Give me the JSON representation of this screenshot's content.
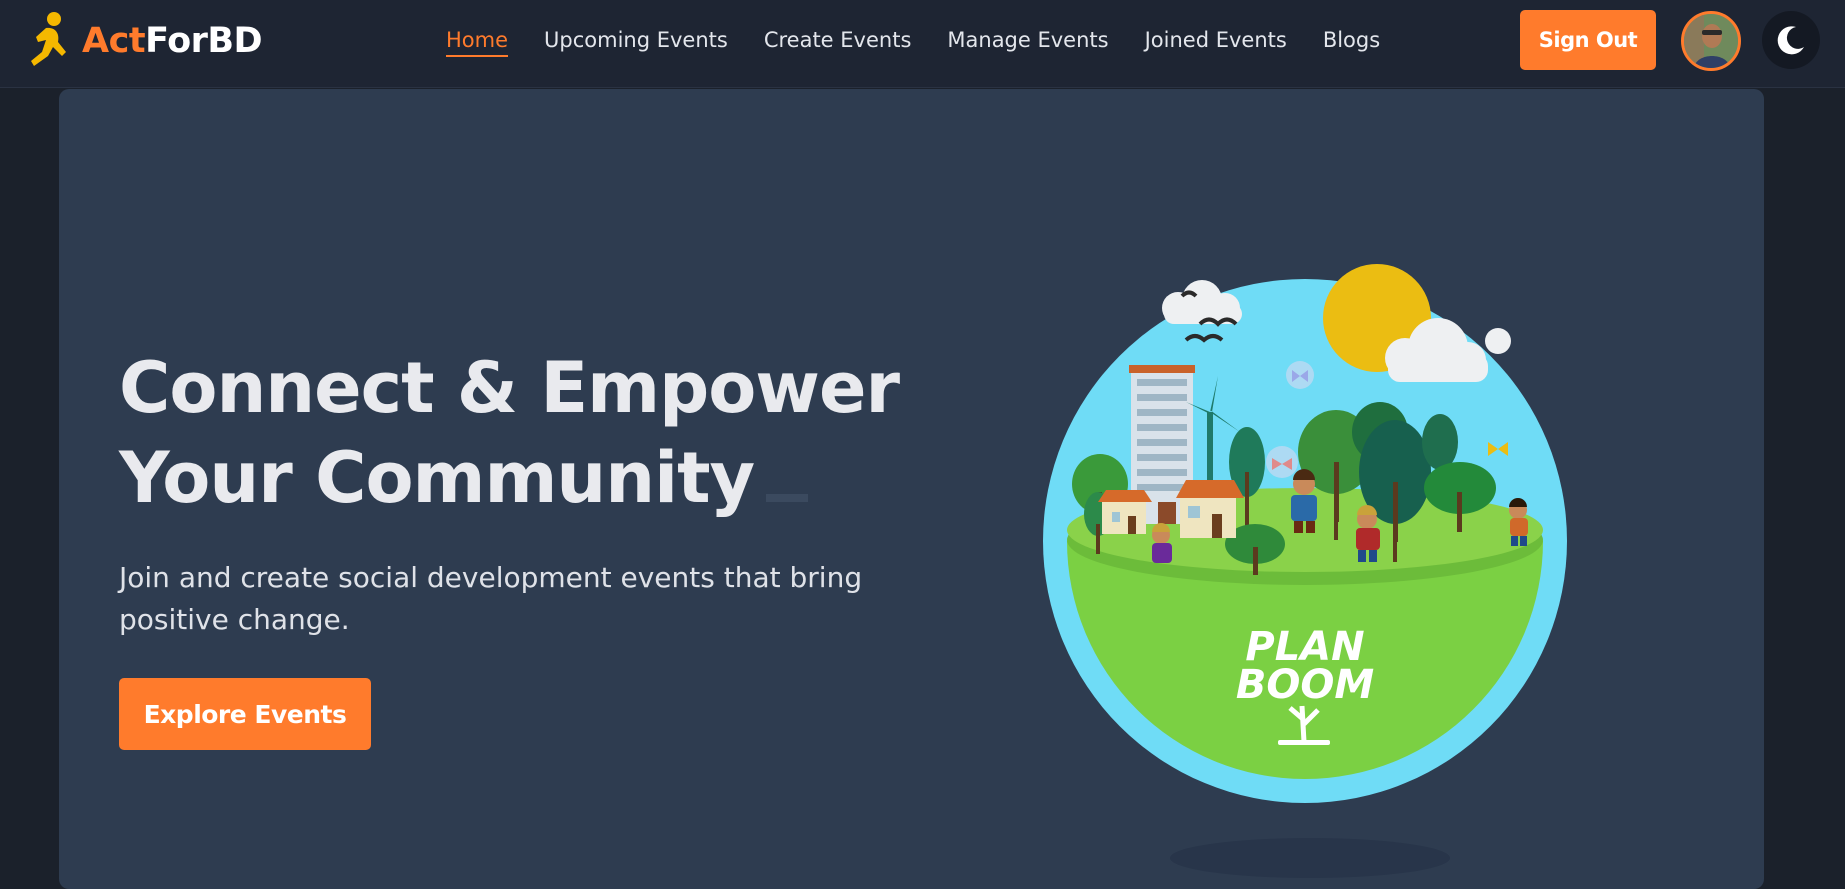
{
  "brand": {
    "name_prefix": "Act",
    "name_suffix": "ForBD",
    "accent_color": "#ff7b2c"
  },
  "nav": {
    "links": [
      {
        "label": "Home",
        "active": true
      },
      {
        "label": "Upcoming Events",
        "active": false
      },
      {
        "label": "Create Events",
        "active": false
      },
      {
        "label": "Manage Events",
        "active": false
      },
      {
        "label": "Joined Events",
        "active": false
      },
      {
        "label": "Blogs",
        "active": false
      }
    ],
    "signout_label": "Sign Out",
    "theme_icon": "moon-icon"
  },
  "hero": {
    "title_line1": "Connect & Empower",
    "title_line2": "Your Community",
    "subtitle": "Join and create social development events that bring positive change.",
    "cta_label": "Explore Events",
    "illustration_text_line1": "PLAN",
    "illustration_text_line2": "BOOM"
  },
  "colors": {
    "navbar_bg": "#1e2533",
    "hero_bg": "#2e3c50",
    "page_bg": "#1b212b",
    "button": "#ff7b2c"
  }
}
